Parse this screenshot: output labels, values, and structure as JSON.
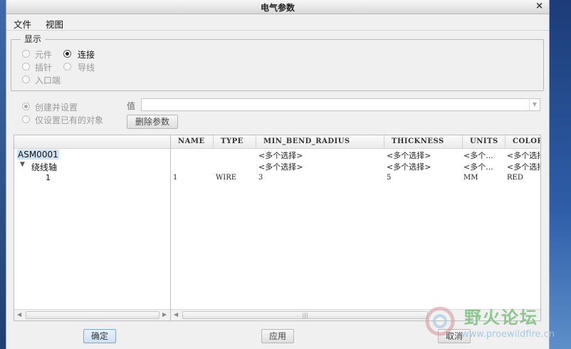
{
  "window": {
    "title": "电气参数",
    "close_glyph": "×"
  },
  "menu": [
    "文件",
    "视图"
  ],
  "display_group": {
    "legend": "显示",
    "options": [
      {
        "label": "元件",
        "checked": false,
        "enabled": false
      },
      {
        "label": "连接",
        "checked": true,
        "enabled": true
      },
      {
        "label": "插针",
        "checked": false,
        "enabled": false
      },
      {
        "label": "导线",
        "checked": false,
        "enabled": false
      },
      {
        "label": "入口端",
        "checked": false,
        "enabled": false
      }
    ]
  },
  "mode": {
    "create_and_set": "创建并设置",
    "set_existing_only": "仅设置已有的对象"
  },
  "value": {
    "label": "值",
    "current": ""
  },
  "delete_param_button": "删除参数",
  "tree": [
    {
      "label": "ASM0001",
      "selected": true
    },
    {
      "label": "绕线轴",
      "expander": "▼"
    },
    {
      "label": "1"
    }
  ],
  "table": {
    "columns": [
      "NAME",
      "TYPE",
      "MIN_BEND_RADIUS",
      "THICKNESS",
      "UNITS",
      "COLOR"
    ],
    "rows": [
      [
        "",
        "",
        "<多个选择>",
        "<多个选择>",
        "<多个...",
        "<多个选择"
      ],
      [
        "",
        "",
        "<多个选择>",
        "<多个选择>",
        "<多个...",
        "<多个选择"
      ],
      [
        "1",
        "WIRE",
        "3",
        "5",
        "MM",
        "RED"
      ]
    ],
    "scroll_thumb_glyph": "|||"
  },
  "footer": {
    "ok": "确定",
    "apply": "应用",
    "cancel": "取消"
  },
  "watermark": {
    "text": "野火论坛",
    "url": "www.proewildfire.cn"
  },
  "colors": {
    "selection": "#cfe3f7",
    "desktop": "#2b4f86",
    "accent": "#7ea6d8"
  }
}
